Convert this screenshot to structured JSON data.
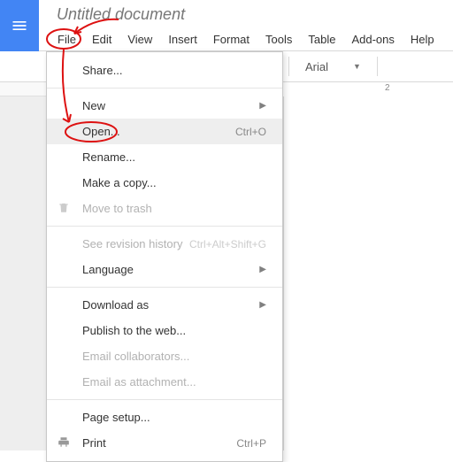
{
  "title": "Untitled document",
  "menubar": [
    "File",
    "Edit",
    "View",
    "Insert",
    "Format",
    "Tools",
    "Table",
    "Add-ons",
    "Help"
  ],
  "toolbar": {
    "font": "Arial"
  },
  "ruler": {
    "mark": "2"
  },
  "fileMenu": {
    "share": "Share...",
    "new": "New",
    "open": "Open...",
    "open_shortcut": "Ctrl+O",
    "rename": "Rename...",
    "makecopy": "Make a copy...",
    "trash": "Move to trash",
    "revision": "See revision history",
    "revision_shortcut": "Ctrl+Alt+Shift+G",
    "language": "Language",
    "download": "Download as",
    "publish": "Publish to the web...",
    "emailcollab": "Email collaborators...",
    "emailattach": "Email as attachment...",
    "pagesetup": "Page setup...",
    "print": "Print",
    "print_shortcut": "Ctrl+P"
  }
}
